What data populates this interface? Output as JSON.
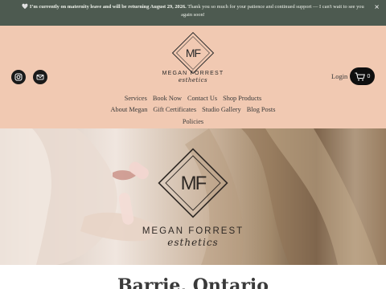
{
  "announcement": {
    "bold": "I’m currently on maternity leave and will be returning August 29, 2026.",
    "text": " Thank you so much for your patience and continued support — I can't wait to see you again soon!",
    "heart": "🤍",
    "close": "×"
  },
  "brand": {
    "monogram": "MF",
    "name": "MEGAN FORREST",
    "tagline": "esthetics"
  },
  "header": {
    "login": "Login",
    "cart_count": "0"
  },
  "nav": {
    "row1": [
      "Services",
      "Book Now",
      "Contact Us",
      "Shop Products"
    ],
    "row2": [
      "About Megan",
      "Gift Certificates",
      "Studio Gallery",
      "Blog Posts"
    ],
    "row3": [
      "Policies"
    ]
  },
  "page": {
    "heading": "Barrie, Ontario"
  },
  "icons": {
    "instagram": "instagram-icon",
    "email": "email-icon",
    "cart": "shopping-cart-icon",
    "close": "close-icon"
  },
  "colors": {
    "announcement_bg": "#4d5a50",
    "header_bg": "#f1c9b2",
    "button_dark": "#0f0f0f"
  }
}
